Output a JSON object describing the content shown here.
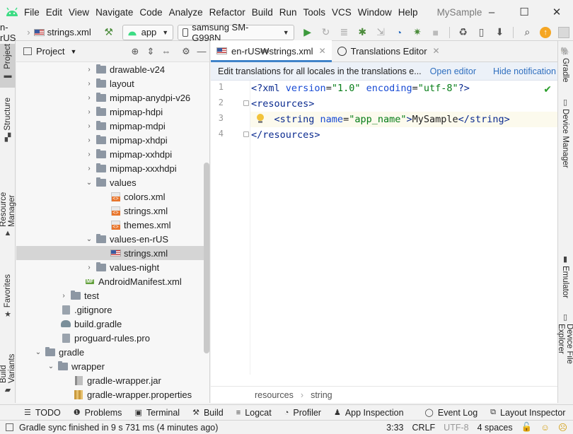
{
  "menubar": {
    "items": [
      "File",
      "Edit",
      "View",
      "Navigate",
      "Code",
      "Analyze",
      "Refactor",
      "Build",
      "Run",
      "Tools",
      "VCS",
      "Window",
      "Help"
    ],
    "project_name": "MySample",
    "win_minimize": "–",
    "win_maximize": "☐",
    "win_close": "✕"
  },
  "toolbar": {
    "breadcrumb_1": "n-rUS",
    "breadcrumb_2": "strings.xml",
    "run_config": "app",
    "device": "samsung SM-G998N"
  },
  "left_strip": {
    "project": "Project",
    "structure": "Structure",
    "resource_manager": "Resource Manager",
    "favorites": "Favorites",
    "build_variants": "Build Variants"
  },
  "right_strip": {
    "gradle": "Gradle",
    "device_manager": "Device Manager",
    "emulator": "Emulator",
    "device_file_explorer": "Device File Explorer"
  },
  "project_panel": {
    "title": "Project",
    "rows": [
      {
        "label": "drawable-v24"
      },
      {
        "label": "layout"
      },
      {
        "label": "mipmap-anydpi-v26"
      },
      {
        "label": "mipmap-hdpi"
      },
      {
        "label": "mipmap-mdpi"
      },
      {
        "label": "mipmap-xhdpi"
      },
      {
        "label": "mipmap-xxhdpi"
      },
      {
        "label": "mipmap-xxxhdpi"
      },
      {
        "label": "values"
      },
      {
        "label": "colors.xml"
      },
      {
        "label": "strings.xml"
      },
      {
        "label": "themes.xml"
      },
      {
        "label": "values-en-rUS"
      },
      {
        "label": "strings.xml"
      },
      {
        "label": "values-night"
      },
      {
        "label": "AndroidManifest.xml"
      },
      {
        "label": "test"
      },
      {
        "label": ".gitignore"
      },
      {
        "label": "build.gradle"
      },
      {
        "label": "proguard-rules.pro"
      },
      {
        "label": "gradle"
      },
      {
        "label": "wrapper"
      },
      {
        "label": "gradle-wrapper.jar"
      },
      {
        "label": "gradle-wrapper.properties"
      }
    ]
  },
  "editor": {
    "tabs": [
      {
        "label": "en-rUS₩strings.xml"
      },
      {
        "label": "Translations Editor"
      }
    ],
    "notification": {
      "text": "Edit translations for all locales in the translations e...",
      "open_editor": "Open editor",
      "hide": "Hide notification"
    },
    "line_numbers": [
      "1",
      "2",
      "3",
      "4"
    ],
    "code": {
      "l1_a": "<?",
      "l1_b": "xml ",
      "l1_c": "version",
      "l1_d": "=",
      "l1_e": "\"1.0\"",
      "l1_f": " encoding",
      "l1_g": "=",
      "l1_h": "\"utf-8\"",
      "l1_i": "?>",
      "l2": "<resources>",
      "l3_a": "    <string ",
      "l3_b": "name",
      "l3_c": "=",
      "l3_d": "\"app_name\"",
      "l3_e": ">",
      "l3_f": "MySample",
      "l3_g": "</string>",
      "l4": "</resources>"
    },
    "breadcrumb": [
      "resources",
      "string"
    ]
  },
  "bottom_tools": [
    "TODO",
    "Problems",
    "Terminal",
    "Build",
    "Logcat",
    "Profiler",
    "App Inspection",
    "Event Log",
    "Layout Inspector"
  ],
  "status": {
    "message": "Gradle sync finished in 9 s 731 ms (4 minutes ago)",
    "position": "3:33",
    "line_sep": "CRLF",
    "encoding": "UTF-8",
    "indent": "4 spaces"
  },
  "colors": {
    "accent": "#4083c9",
    "android_green": "#3ddc84",
    "selection": "#d5d5d5"
  }
}
